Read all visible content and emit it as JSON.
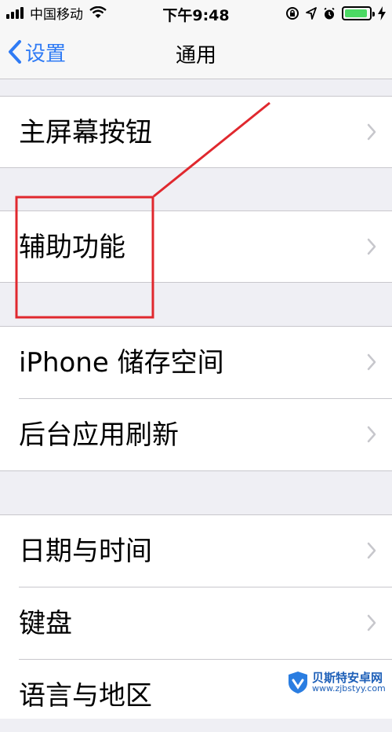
{
  "status_bar": {
    "carrier": "中国移动",
    "time": "下午9:48",
    "battery_level": 0.92
  },
  "nav": {
    "back_label": "设置",
    "title": "通用"
  },
  "groups": [
    {
      "items": [
        "主屏幕按钮"
      ]
    },
    {
      "items": [
        "辅助功能"
      ]
    },
    {
      "items": [
        "iPhone 储存空间",
        "后台应用刷新"
      ]
    },
    {
      "items": [
        "日期与时间",
        "键盘",
        "语言与地区"
      ]
    }
  ],
  "watermark": {
    "title": "贝斯特安卓网",
    "url": "www.zjbstyy.com"
  },
  "colors": {
    "tint": "#2f7bf5",
    "annotation": "#e0282e",
    "battery": "#4cd964"
  }
}
